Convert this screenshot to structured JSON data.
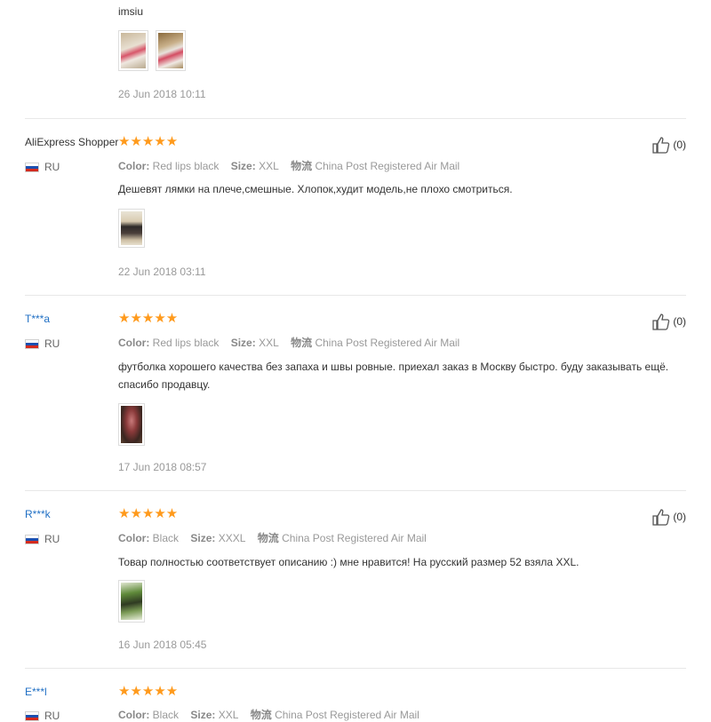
{
  "top_review": {
    "text_tail": "imsiu",
    "date": "26 Jun 2018 10:11",
    "thumb_count": 2
  },
  "labels": {
    "color": "Color:",
    "size": "Size:",
    "logistics": "物流"
  },
  "reviews": [
    {
      "name": "AliExpress Shopper",
      "country": "RU",
      "color": "Red lips black",
      "size": "XXL",
      "shipping": "China Post Registered Air Mail",
      "text": "Дешевят лямки на плече,смешные. Хлопок,худит модель,не плохо смотриться.",
      "date": "22 Jun 2018 03:11",
      "helpful": "(0)"
    },
    {
      "name": "T***a",
      "country": "RU",
      "color": "Red lips black",
      "size": "XXL",
      "shipping": "China Post Registered Air Mail",
      "text": "футболка хорошего качества без запаха и швы ровные. приехал заказ в Москву быстро. буду заказывать ещё. спасибо продавцу.",
      "date": "17 Jun 2018 08:57",
      "helpful": "(0)"
    },
    {
      "name": "R***k",
      "country": "RU",
      "color": "Black",
      "size": "XXXL",
      "shipping": "China Post Registered Air Mail",
      "text": "Товар полностью соответствует описанию :) мне нравится! На русский размер 52 взяла XXL.",
      "date": "16 Jun 2018 05:45",
      "helpful": "(0)"
    },
    {
      "name": "E***l",
      "country": "RU",
      "color": "Black",
      "size": "XXL",
      "shipping": "China Post Registered Air Mail"
    }
  ],
  "colors": {
    "star": "#ff9a1c",
    "link": "#1f6fc4",
    "muted": "#999999"
  }
}
